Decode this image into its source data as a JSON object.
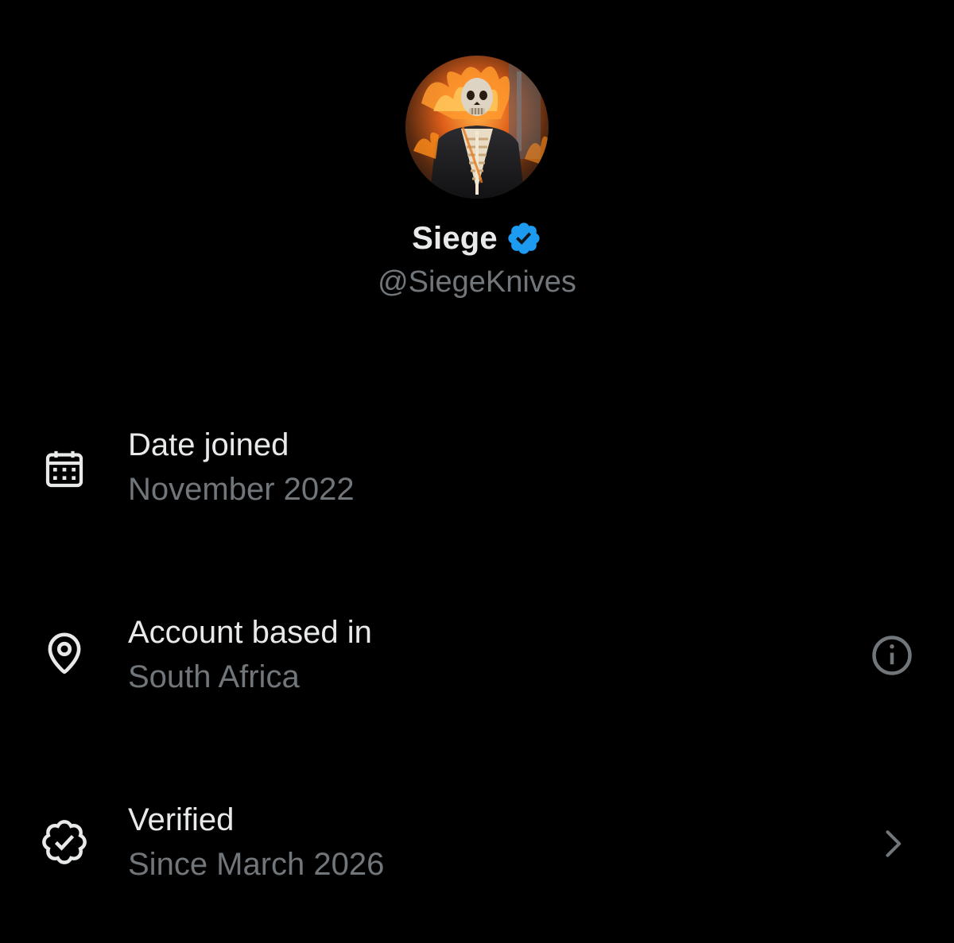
{
  "profile": {
    "display_name": "Siege",
    "handle": "@SiegeKnives",
    "avatar_icon": "avatar-flaming-skeleton",
    "verified_badge_icon": "verified-badge-icon",
    "verified_color": "#1d9bf0"
  },
  "details": [
    {
      "title": "Date joined",
      "value": "November 2022",
      "icon": "calendar-icon"
    },
    {
      "title": "Account based in",
      "value": "South Africa",
      "icon": "location-pin-icon",
      "action_icon": "info-icon"
    },
    {
      "title": "Verified",
      "value": "Since March 2026",
      "icon": "verified-outline-icon",
      "action_icon": "chevron-right-icon"
    }
  ],
  "colors": {
    "background": "#000000",
    "primary_text": "#e7e9ea",
    "secondary_text": "#71767b",
    "accent": "#1d9bf0"
  }
}
